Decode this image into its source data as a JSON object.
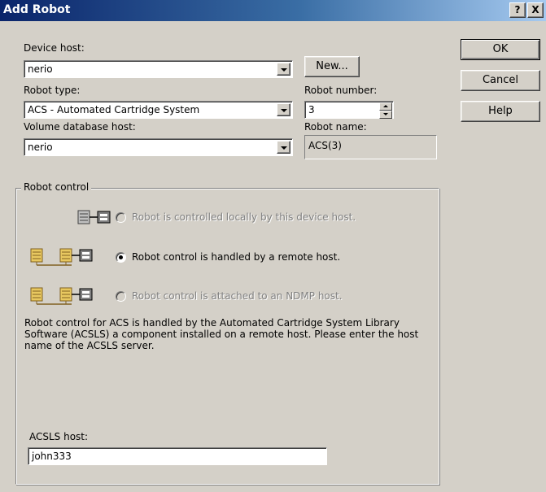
{
  "window": {
    "title": "Add Robot",
    "help_glyph": "?",
    "close_glyph": "X"
  },
  "form": {
    "device_host_label": "Device host:",
    "device_host_value": "nerio",
    "new_button": "New...",
    "robot_type_label": "Robot type:",
    "robot_type_value": "ACS - Automated Cartridge System",
    "robot_number_label": "Robot number:",
    "robot_number_value": "3",
    "volume_db_label": "Volume database host:",
    "volume_db_value": "nerio",
    "robot_name_label": "Robot name:",
    "robot_name_value": "ACS(3)"
  },
  "buttons": {
    "ok": "OK",
    "cancel": "Cancel",
    "help": "Help"
  },
  "robot_control": {
    "legend": "Robot control",
    "options": [
      {
        "label": "Robot is controlled locally by this device host.",
        "checked": false,
        "enabled": false,
        "icon": "local-host-robot-icon"
      },
      {
        "label": "Robot control is handled by a remote host.",
        "checked": true,
        "enabled": true,
        "icon": "remote-host-robot-icon"
      },
      {
        "label": "Robot control is attached to an NDMP host.",
        "checked": false,
        "enabled": false,
        "icon": "ndmp-host-robot-icon"
      }
    ],
    "description": "Robot control for ACS is handled by the Automated Cartridge System Library Software (ACSLS) a component installed on a remote host. Please enter the host name of the ACSLS server.",
    "acsls_label": "ACSLS host:",
    "acsls_value": "john333"
  }
}
